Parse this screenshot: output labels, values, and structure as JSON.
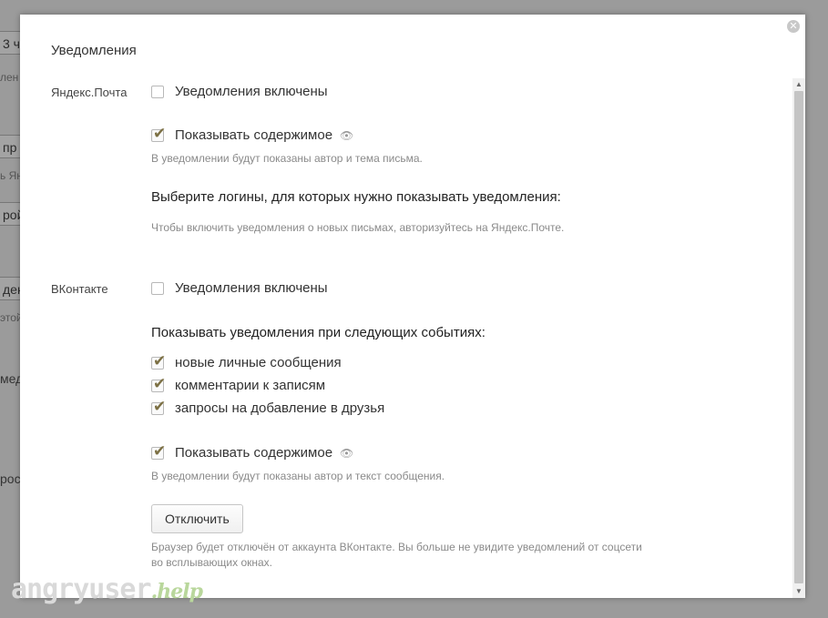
{
  "background": {
    "fragments": [
      "3 ч",
      "лен",
      "пр",
      "ь Янд",
      "рой",
      "декс",
      "этой",
      "мед",
      "рост"
    ]
  },
  "dialog": {
    "title": "Уведомления",
    "close_icon": "close-icon",
    "yandex_mail": {
      "section_label": "Яндекс.Почта",
      "enable_label": "Уведомления включены",
      "enable_checked": false,
      "show_content_label": "Показывать содержимое",
      "show_content_checked": true,
      "show_content_hint": "В уведомлении будут показаны автор и тема письма.",
      "logins_heading": "Выберите логины, для которых нужно показывать уведомления:",
      "logins_hint": "Чтобы включить уведомления о новых письмах, авторизуйтесь на Яндекс.Почте."
    },
    "vkontakte": {
      "section_label": "ВКонтакте",
      "enable_label": "Уведомления включены",
      "enable_checked": false,
      "events_heading": "Показывать уведомления при следующих событиях:",
      "events": [
        {
          "label": "новые личные сообщения",
          "checked": true
        },
        {
          "label": "комментарии к записям",
          "checked": true
        },
        {
          "label": "запросы на добавление в друзья",
          "checked": true
        }
      ],
      "show_content_label": "Показывать содержимое",
      "show_content_checked": true,
      "show_content_hint": "В уведомлении будут показаны автор и текст сообщения.",
      "disconnect_button": "Отключить",
      "disconnect_hint_line1": "Браузер будет отключён от аккаунта ВКонтакте. Вы больше не увидите уведомлений от соцсети",
      "disconnect_hint_line2": "во всплывающих окнах."
    }
  },
  "watermark": {
    "text": "angryuser",
    "suffix": ".help"
  },
  "glyphs": {
    "check": "✔",
    "eye": "👁",
    "close": "✕",
    "up": "▲",
    "down": "▼"
  }
}
